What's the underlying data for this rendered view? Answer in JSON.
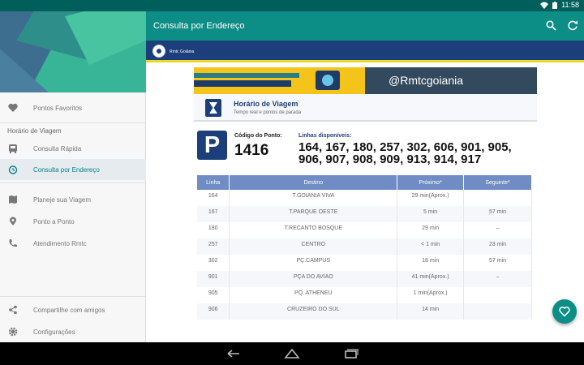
{
  "status_bar": {
    "time": "11:58"
  },
  "app_bar": {
    "title": "Consulta por Endereço"
  },
  "brand_bar": {
    "label": "Rmtc Goiânia"
  },
  "drawer": {
    "favorites": "Pontos Favoritos",
    "section_title": "Horário de Viagem",
    "items": [
      "Consulta Rápida",
      "Consulta por Endereço",
      "Planeje sua Viagem",
      "Ponto a Ponto",
      "Atendimento Rmtc"
    ],
    "share": "Compartilhe com amigos",
    "settings": "Configurações"
  },
  "banner": {
    "handle": "@Rmtcgoiania"
  },
  "page_header": {
    "title": "Horário de Viagem",
    "subtitle": "Tempo real e pontos de parada"
  },
  "stop": {
    "badge": "P",
    "code_label": "Código do Ponto:",
    "code": "1416",
    "lines_label": "Linhas disponíveis:",
    "lines": "164, 167, 180, 257, 302, 606, 901, 905, 906, 907, 908, 909, 913, 914, 917"
  },
  "table": {
    "headers": [
      "Linha",
      "Destino",
      "Próximo*",
      "Seguinte*"
    ],
    "rows": [
      {
        "linha": "164",
        "destino": "T.GOIANIA VIVA",
        "proximo": "29 min",
        "proximo_sub": "(Aprox.)",
        "seguinte": ""
      },
      {
        "linha": "167",
        "destino": "T.PARQUE OESTE",
        "proximo": "5 min",
        "proximo_sub": "",
        "seguinte": "57 min"
      },
      {
        "linha": "180",
        "destino": "T.RECANTO BOSQUE",
        "proximo": "29 min",
        "proximo_sub": "",
        "seguinte": "–"
      },
      {
        "linha": "257",
        "destino": "CENTRO",
        "proximo": "< 1 min",
        "proximo_sub": "",
        "seguinte": "23 min"
      },
      {
        "linha": "302",
        "destino": "PÇ.CAMPUS",
        "proximo": "18 min",
        "proximo_sub": "",
        "seguinte": "57 min"
      },
      {
        "linha": "901",
        "destino": "PÇA DO AVIAO",
        "proximo": "41 min",
        "proximo_sub": "(Aprox.)",
        "seguinte": "–"
      },
      {
        "linha": "905",
        "destino": "PQ. ATHENEU",
        "proximo": "1 min",
        "proximo_sub": "(Aprox.)",
        "seguinte": ""
      },
      {
        "linha": "906",
        "destino": "CRUZEIRO DO SUL",
        "proximo": "14 min",
        "proximo_sub": "",
        "seguinte": ""
      }
    ]
  },
  "colors": {
    "teal": "#0c8d85",
    "navy": "#1c3e7a",
    "table_header": "#6f8cc4"
  }
}
